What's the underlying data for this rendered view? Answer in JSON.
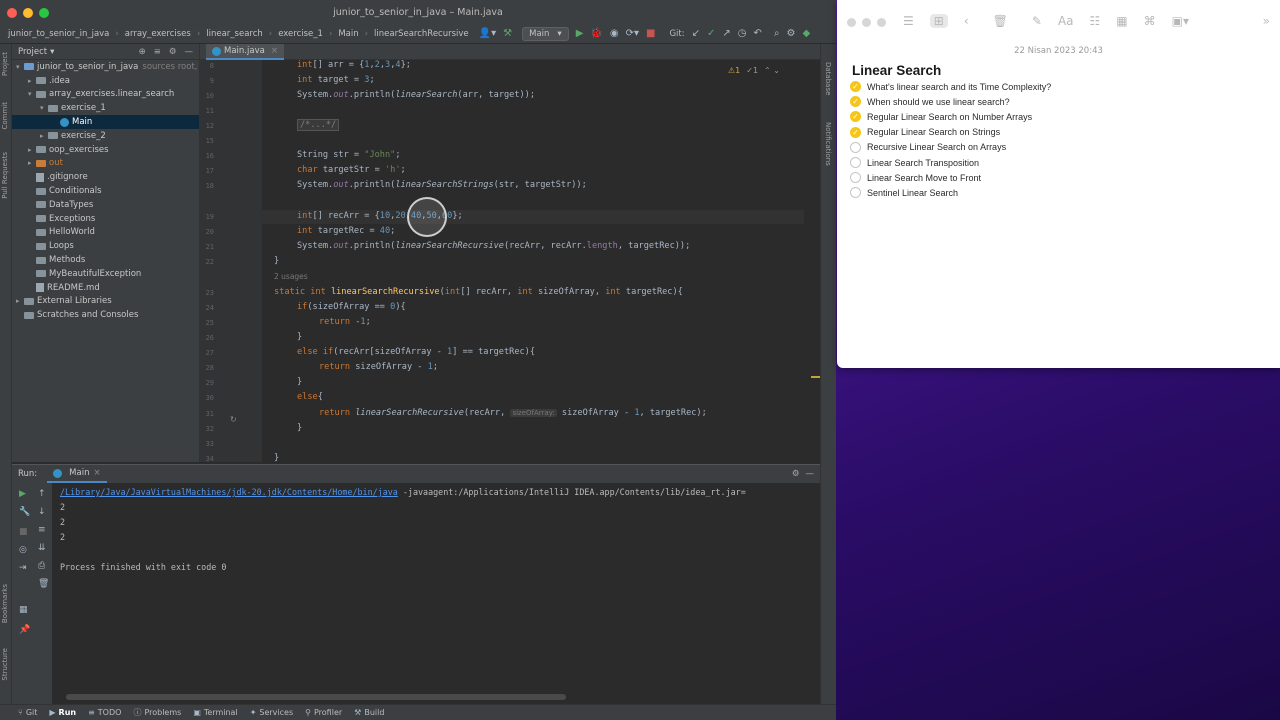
{
  "ide": {
    "window_title": "junior_to_senior_in_java – Main.java",
    "breadcrumbs": [
      "junior_to_senior_in_java",
      "array_exercises",
      "linear_search",
      "exercise_1",
      "Main",
      "linearSearchRecursive"
    ],
    "run_config": "Main",
    "git_label": "Git:",
    "project_panel": {
      "title": "Project",
      "tree": [
        {
          "label": "junior_to_senior_in_java",
          "suffix": "sources root,",
          "indent": 0,
          "kind": "folder-blue",
          "arrow": "▾"
        },
        {
          "label": ".idea",
          "indent": 1,
          "kind": "folder",
          "arrow": "▸"
        },
        {
          "label": "array_exercises.linear_search",
          "indent": 1,
          "kind": "folder",
          "arrow": "▾"
        },
        {
          "label": "exercise_1",
          "indent": 2,
          "kind": "folder",
          "arrow": "▾"
        },
        {
          "label": "Main",
          "indent": 3,
          "kind": "java",
          "arrow": "",
          "selected": true
        },
        {
          "label": "exercise_2",
          "indent": 2,
          "kind": "folder",
          "arrow": "▸"
        },
        {
          "label": "oop_exercises",
          "indent": 1,
          "kind": "folder",
          "arrow": "▸"
        },
        {
          "label": "out",
          "indent": 1,
          "kind": "folder-orange",
          "arrow": "▸"
        },
        {
          "label": ".gitignore",
          "indent": 1,
          "kind": "text",
          "arrow": ""
        },
        {
          "label": "Conditionals",
          "indent": 1,
          "kind": "folder",
          "arrow": ""
        },
        {
          "label": "DataTypes",
          "indent": 1,
          "kind": "folder",
          "arrow": ""
        },
        {
          "label": "Exceptions",
          "indent": 1,
          "kind": "folder",
          "arrow": ""
        },
        {
          "label": "HelloWorld",
          "indent": 1,
          "kind": "folder",
          "arrow": ""
        },
        {
          "label": "Loops",
          "indent": 1,
          "kind": "folder",
          "arrow": ""
        },
        {
          "label": "Methods",
          "indent": 1,
          "kind": "folder",
          "arrow": ""
        },
        {
          "label": "MyBeautifulException",
          "indent": 1,
          "kind": "folder",
          "arrow": ""
        },
        {
          "label": "README.md",
          "indent": 1,
          "kind": "text",
          "arrow": ""
        },
        {
          "label": "External Libraries",
          "indent": 0,
          "kind": "lib",
          "arrow": "▸"
        },
        {
          "label": "Scratches and Consoles",
          "indent": 0,
          "kind": "scratch",
          "arrow": ""
        }
      ]
    },
    "editor_tab": "Main.java",
    "inspections": {
      "warnings": "1",
      "weak": "1"
    },
    "side_labels": {
      "project": "Project",
      "commit": "Commit",
      "pull_requests": "Pull Requests",
      "bookmarks": "Bookmarks",
      "structure": "Structure",
      "database": "Database",
      "notifications": "Notifications"
    },
    "code": [
      {
        "n": "8",
        "text": "int[] arr = {1,2,3,4};"
      },
      {
        "n": "9",
        "text": "int target = 3;"
      },
      {
        "n": "10",
        "text": "System.out.println(linearSearch(arr, target));"
      },
      {
        "n": "11",
        "text": ""
      },
      {
        "n": "12",
        "text": "/*...*/"
      },
      {
        "n": "15",
        "text": ""
      },
      {
        "n": "16",
        "text": "String str = \"John\";"
      },
      {
        "n": "17",
        "text": "char targetStr = 'h';"
      },
      {
        "n": "18",
        "text": "System.out.println(linearSearchStrings(str, targetStr));"
      },
      {
        "n": "18b",
        "text": ""
      },
      {
        "n": "19",
        "text": "int[] recArr = {10,20,40,50,60};"
      },
      {
        "n": "20",
        "text": "int targetRec = 40;"
      },
      {
        "n": "21",
        "text": "System.out.println(linearSearchRecursive(recArr, recArr.length, targetRec));"
      },
      {
        "n": "22",
        "text": "}"
      },
      {
        "n": "usages",
        "text": "2 usages"
      },
      {
        "n": "23",
        "text": "static int linearSearchRecursive(int[] recArr, int sizeOfArray, int targetRec){"
      },
      {
        "n": "24",
        "text": "if(sizeOfArray == 0){"
      },
      {
        "n": "25",
        "text": "return -1;"
      },
      {
        "n": "26",
        "text": "}"
      },
      {
        "n": "27",
        "text": "else if(recArr[sizeOfArray - 1] == targetRec){"
      },
      {
        "n": "28",
        "text": "return sizeOfArray - 1;"
      },
      {
        "n": "29",
        "text": "}"
      },
      {
        "n": "30",
        "text": "else{"
      },
      {
        "n": "31",
        "text": "return linearSearchRecursive(recArr, sizeOfArray: sizeOfArray - 1, targetRec);"
      },
      {
        "n": "32",
        "text": "}"
      },
      {
        "n": "33",
        "text": ""
      },
      {
        "n": "34",
        "text": "}"
      }
    ],
    "run_panel": {
      "label": "Run:",
      "tab": "Main",
      "console": {
        "cmd_path": "/Library/Java/JavaVirtualMachines/jdk-20.jdk/Contents/Home/bin/java",
        "cmd_args": " -javaagent:/Applications/IntelliJ IDEA.app/Contents/lib/idea_rt.jar=",
        "out1": "2",
        "out2": "2",
        "out3": "2",
        "finish": "Process finished with exit code 0"
      }
    },
    "bottom_tabs": [
      "Git",
      "Run",
      "TODO",
      "Problems",
      "Terminal",
      "Services",
      "Profiler",
      "Build"
    ]
  },
  "notes": {
    "date": "22 Nisan 2023 20:43",
    "title": "Linear Search",
    "items": [
      {
        "label": "What's linear search and its Time Complexity?",
        "done": true
      },
      {
        "label": "When should we use linear search?",
        "done": true
      },
      {
        "label": "Regular Linear Search on Number Arrays",
        "done": true
      },
      {
        "label": "Regular Linear Search on Strings",
        "done": true
      },
      {
        "label": "Recursive Linear Search on Arrays",
        "done": false
      },
      {
        "label": "Linear Search Transposition",
        "done": false
      },
      {
        "label": "Linear Search Move to Front",
        "done": false
      },
      {
        "label": "Sentinel Linear Search",
        "done": false
      }
    ]
  },
  "colors": {
    "accent": "#4a88c7",
    "checked": "#f5c518",
    "keyword": "#cc7832",
    "string": "#6a8759",
    "number": "#6897bb",
    "method": "#ffc66d"
  }
}
